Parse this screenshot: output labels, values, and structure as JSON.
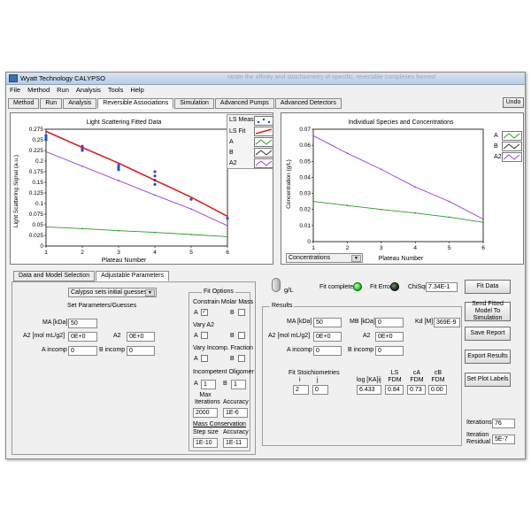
{
  "window": {
    "title": "Wyatt Technology CALYPSO",
    "bg_title": "ntrate the affinity and stoichiometry of specific, reversible complexes formed",
    "undo": "Undo"
  },
  "menu": [
    "File",
    "Method",
    "Run",
    "Analysis",
    "Tools",
    "Help"
  ],
  "tabs": [
    "Method",
    "Run",
    "Analysis",
    "Reversible Associations",
    "Simulation",
    "Advanced Pumps",
    "Advanced Detectors"
  ],
  "active_tab": "Reversible Associations",
  "ls_plot": {
    "title": "Light Scattering Fitted Data",
    "xlabel": "Plateau Number",
    "ylabel": "Light Scattering Signal (a.u.)",
    "xticks": [
      "1",
      "2",
      "3",
      "4",
      "5",
      "6"
    ],
    "yticks": [
      "0",
      "0.025",
      "0.05",
      "0.075",
      "0.1",
      "0.125",
      "0.15",
      "0.175",
      "0.2",
      "0.225",
      "0.25",
      "0.275"
    ],
    "legend": [
      "LS Meas.",
      "LS Fit",
      "A",
      "B",
      "A2"
    ]
  },
  "conc_plot": {
    "title": "Individual Species and Concentrations",
    "xlabel": "Plateau Number",
    "ylabel": "Concentration (g/L)",
    "xticks": [
      "1",
      "2",
      "3",
      "4",
      "5",
      "6"
    ],
    "yticks": [
      "0",
      "0.01",
      "0.02",
      "0.03",
      "0.04",
      "0.05",
      "0.06",
      "0.07"
    ],
    "legend": [
      "A",
      "B",
      "A2"
    ],
    "dropdown": "Concentrations"
  },
  "chart_data": [
    {
      "type": "scatter",
      "title": "Light Scattering Fitted Data",
      "xlabel": "Plateau Number",
      "ylabel": "Light Scattering Signal (a.u.)",
      "xlim": [
        1,
        6
      ],
      "ylim": [
        0,
        0.275
      ],
      "series": [
        {
          "name": "LS Meas.",
          "color": "#1f4fd0",
          "points": [
            [
              1,
              0.26
            ],
            [
              1,
              0.255
            ],
            [
              1,
              0.25
            ],
            [
              2,
              0.235
            ],
            [
              2,
              0.23
            ],
            [
              2,
              0.225
            ],
            [
              3,
              0.19
            ],
            [
              3,
              0.185
            ],
            [
              3,
              0.18
            ],
            [
              4,
              0.175
            ],
            [
              4,
              0.165
            ],
            [
              4,
              0.155
            ],
            [
              4,
              0.145
            ],
            [
              5,
              0.11
            ],
            [
              6,
              0.065
            ]
          ]
        },
        {
          "name": "LS Fit",
          "color": "#e02020",
          "points": [
            [
              1,
              0.27
            ],
            [
              2,
              0.232
            ],
            [
              3,
              0.195
            ],
            [
              4,
              0.155
            ],
            [
              5,
              0.115
            ],
            [
              6,
              0.07
            ]
          ]
        },
        {
          "name": "A",
          "color": "#2a9a2a",
          "points": [
            [
              1,
              0.045
            ],
            [
              2,
              0.041
            ],
            [
              3,
              0.036
            ],
            [
              4,
              0.032
            ],
            [
              5,
              0.027
            ],
            [
              6,
              0.022
            ]
          ]
        },
        {
          "name": "A2",
          "color": "#9a40d0",
          "points": [
            [
              1,
              0.222
            ],
            [
              2,
              0.188
            ],
            [
              3,
              0.154
            ],
            [
              4,
              0.12
            ],
            [
              5,
              0.087
            ],
            [
              6,
              0.048
            ]
          ]
        }
      ]
    },
    {
      "type": "line",
      "title": "Individual Species and Concentrations",
      "xlabel": "Plateau Number",
      "ylabel": "Concentration (g/L)",
      "xlim": [
        1,
        6
      ],
      "ylim": [
        0,
        0.07
      ],
      "series": [
        {
          "name": "A",
          "color": "#2a9a2a",
          "points": [
            [
              1,
              0.025
            ],
            [
              2,
              0.0225
            ],
            [
              3,
              0.02
            ],
            [
              4,
              0.0178
            ],
            [
              5,
              0.0152
            ],
            [
              6,
              0.012
            ]
          ]
        },
        {
          "name": "A2",
          "color": "#9a40d0",
          "points": [
            [
              1,
              0.066
            ],
            [
              2,
              0.055
            ],
            [
              3,
              0.045
            ],
            [
              4,
              0.034
            ],
            [
              5,
              0.025
            ],
            [
              6,
              0.014
            ]
          ]
        }
      ]
    }
  ],
  "left_tabs": [
    "Data and Model Selection",
    "Adjustable Parameters"
  ],
  "guess_select": "Calypso sets initial guesses",
  "set_params_title": "Set Parameters/Guesses",
  "params": {
    "ma_label": "MA [kDa]",
    "ma_value": "50",
    "a2_label": "A2 [mol mL/g2]",
    "a2_value": "0E+0",
    "a2b_label": "A2",
    "a2b_value": "0E+0",
    "aincomp_label": "A incomp",
    "aincomp_value": "0",
    "bincomp_label": "B incomp",
    "bincomp_value": "0"
  },
  "fit_options": {
    "title": "Fit Options",
    "constrain": "Constrain Molar Mass",
    "vary_a2": "Vary A2",
    "vary_incomp": "Vary Incomp. Fraction",
    "incompetent": "Incompetent Oligomer",
    "a": "A",
    "b": "B",
    "a_olig": "1",
    "b_olig": "1",
    "max_iter_label": "Max Iterations",
    "accuracy_label": "Accuracy",
    "max_iter_value": "2000",
    "accuracy_value": "1E-6",
    "mass_cons": "Mass Conservation",
    "step_label": "Step size",
    "accuracy2_label": "Accuracy",
    "step_value": "1E-10",
    "accuracy2_value": "1E-11"
  },
  "status": {
    "gl": "g/L",
    "fit_complete": "Fit complete",
    "fit_error": "Fit Error",
    "chisq_label": "ChiSqr",
    "chisq_value": "7.34E-1"
  },
  "results": {
    "title": "Results",
    "ma_label": "MA [kDa]",
    "ma_value": "50",
    "mb_label": "MB [kDa]",
    "mb_value": "0",
    "kd_label": "Kd [M]",
    "kd_value": "369E-9",
    "a2_label": "A2 [mol mL/g2]",
    "a2_value": "0E+0",
    "a2b_label": "A2",
    "a2b_value": "0E+0",
    "aincomp_label": "A incomp",
    "aincomp_value": "0",
    "bincomp_label": "B incomp",
    "bincomp_value": "0",
    "stoich_label": "Fit Stoichiometries",
    "i_label": "i",
    "j_label": "j",
    "i_value": "2",
    "j_value": "0",
    "logka_label": "log [KA]ij",
    "logka_value": "6.433",
    "ls_fdm_label": "LS FDM",
    "ls_fdm_value": "0.84",
    "ca_fdm_label": "cA FDM",
    "ca_fdm_value": "0.73",
    "cb_fdm_label": "cB FDM",
    "cb_fdm_value": "0.00"
  },
  "buttons": [
    "Fit Data",
    "Send Fitted Model To Simulation",
    "Save Report",
    "Export Results",
    "Set Plot Labels"
  ],
  "iterations": {
    "label": "Iterations",
    "value": "76",
    "residual_label": "Iteration Residual",
    "residual_value": "5E-7"
  },
  "colors": {
    "meas": "#1f4fd0",
    "fit": "#e02020",
    "a": "#2a9a2a",
    "a2": "#9a40d0",
    "fit_complete_led": "#22cc22",
    "fit_error_led": "#1a3a1a"
  }
}
